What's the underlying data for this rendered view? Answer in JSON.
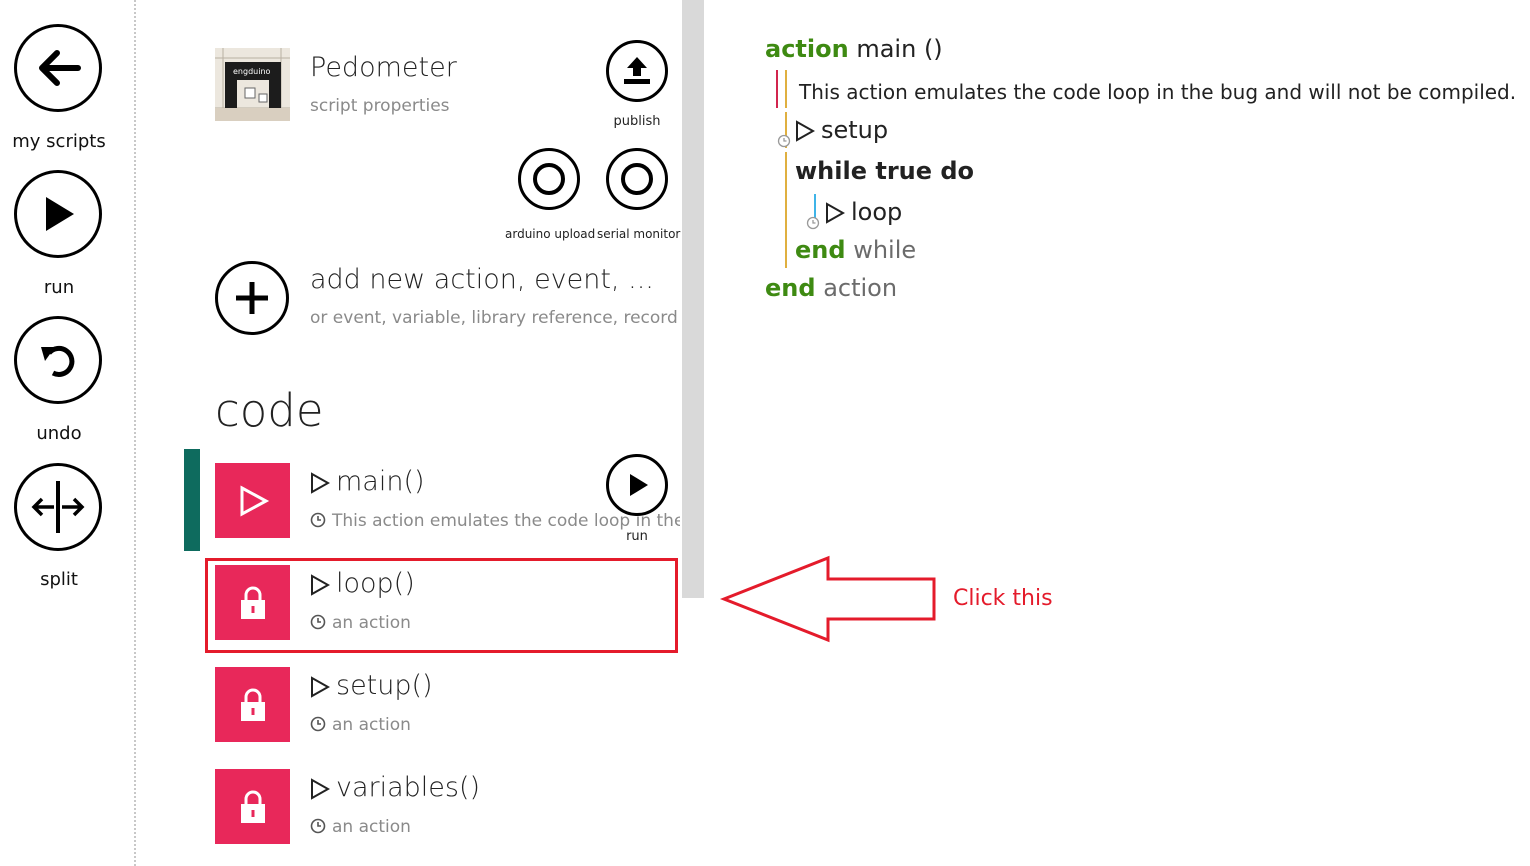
{
  "toolbar": {
    "my_scripts": "my scripts",
    "run": "run",
    "undo": "undo",
    "split": "split"
  },
  "script": {
    "title": "Pedometer",
    "subtitle": "script properties",
    "thumbnail_text": "engduino"
  },
  "header_buttons": {
    "publish": "publish",
    "arduino_upload": "arduino upload",
    "serial_monitor": "serial monitor"
  },
  "add_new": {
    "title": "add new action, event, ...",
    "subtitle": "or event, variable, library reference, record"
  },
  "code_heading": "code",
  "actions": [
    {
      "name": "main()",
      "desc": "This action emulates the code loop in the bug",
      "run_label": "run"
    },
    {
      "name": "loop()",
      "desc": "an action"
    },
    {
      "name": "setup()",
      "desc": "an action"
    },
    {
      "name": "variables()",
      "desc": "an action"
    }
  ],
  "editor": {
    "kw_action": "action",
    "main_sig": "main ()",
    "comment": "This action emulates the code loop in the bug and will not be compiled.",
    "call_setup": "setup",
    "while_line": "while true do",
    "call_loop": "loop",
    "kw_end": "end",
    "end_while": "while",
    "end_action": "action"
  },
  "annotation": {
    "text": "Click this"
  },
  "colors": {
    "accent_tile": "#e8285a",
    "selection_bar": "#0e6b5e",
    "keyword": "#3e8a12",
    "annotation": "#e41b2b"
  }
}
